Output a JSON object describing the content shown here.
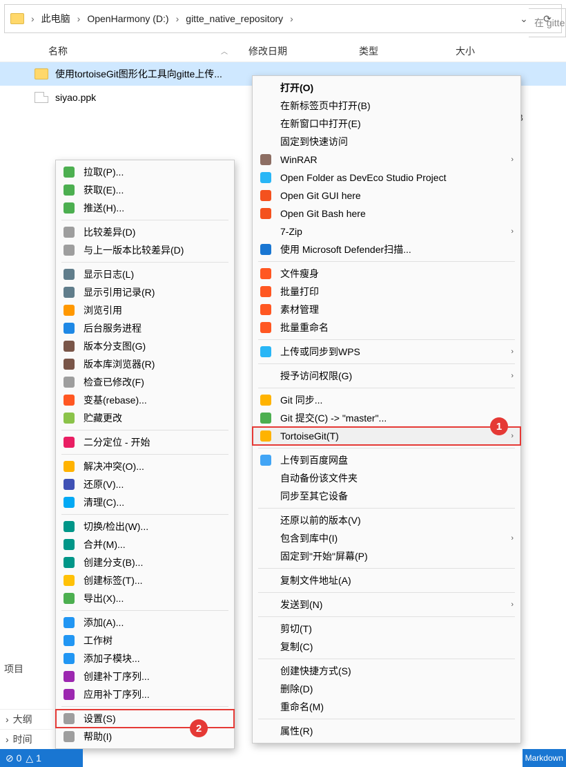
{
  "breadcrumb": {
    "pc": "此电脑",
    "drive": "OpenHarmony (D:)",
    "folder": "gitte_native_repository"
  },
  "search": {
    "prefix": "在 gitte"
  },
  "columns": {
    "name": "名称",
    "date": "修改日期",
    "type": "类型",
    "size": "大小"
  },
  "files": {
    "folder_name": "使用tortoiseGit图形化工具向gitte上传...",
    "file_name": "siyao.ppk",
    "size_suffix": "B"
  },
  "menu1": [
    {
      "k": "open",
      "label": "打开(O)",
      "bold": true
    },
    {
      "k": "newtab",
      "label": "在新标签页中打开(B)"
    },
    {
      "k": "newwin",
      "label": "在新窗口中打开(E)"
    },
    {
      "k": "pin",
      "label": "固定到快速访问"
    },
    {
      "k": "winrar",
      "label": "WinRAR",
      "arrow": true,
      "ico": "rar"
    },
    {
      "k": "deveco",
      "label": "Open Folder as DevEco Studio Project",
      "ico": "dev"
    },
    {
      "k": "gitgui",
      "label": "Open Git GUI here",
      "ico": "git"
    },
    {
      "k": "gitbash",
      "label": "Open Git Bash here",
      "ico": "git"
    },
    {
      "k": "7zip",
      "label": "7-Zip",
      "arrow": true
    },
    {
      "k": "defender",
      "label": "使用 Microsoft Defender扫描...",
      "ico": "shield"
    },
    {
      "sep": true
    },
    {
      "k": "wps1",
      "label": "文件瘦身",
      "ico": "w"
    },
    {
      "k": "wps2",
      "label": "批量打印",
      "ico": "w"
    },
    {
      "k": "wps3",
      "label": "素材管理",
      "ico": "w"
    },
    {
      "k": "wps4",
      "label": "批量重命名",
      "ico": "w"
    },
    {
      "sep": true
    },
    {
      "k": "wpsup",
      "label": "上传或同步到WPS",
      "arrow": true,
      "ico": "cloud"
    },
    {
      "sep": true
    },
    {
      "k": "grant",
      "label": "授予访问权限(G)",
      "arrow": true
    },
    {
      "sep": true
    },
    {
      "k": "gitsync",
      "label": "Git 同步...",
      "ico": "gs"
    },
    {
      "k": "gitcommit",
      "label": "Git 提交(C) -> \"master\"...",
      "ico": "gc"
    },
    {
      "k": "tortoise",
      "label": "TortoiseGit(T)",
      "arrow": true,
      "hl": true,
      "ico": "tg"
    },
    {
      "sep": true
    },
    {
      "k": "baidu",
      "label": "上传到百度网盘",
      "ico": "bd"
    },
    {
      "k": "autobk",
      "label": "自动备份该文件夹"
    },
    {
      "k": "syncdev",
      "label": "同步至其它设备"
    },
    {
      "sep": true
    },
    {
      "k": "restore",
      "label": "还原以前的版本(V)"
    },
    {
      "k": "include",
      "label": "包含到库中(I)",
      "arrow": true
    },
    {
      "k": "pinstart",
      "label": "固定到\"开始\"屏幕(P)"
    },
    {
      "sep": true
    },
    {
      "k": "copyaddr",
      "label": "复制文件地址(A)"
    },
    {
      "sep": true
    },
    {
      "k": "sendto",
      "label": "发送到(N)",
      "arrow": true
    },
    {
      "sep": true
    },
    {
      "k": "cut",
      "label": "剪切(T)"
    },
    {
      "k": "copy",
      "label": "复制(C)"
    },
    {
      "sep": true
    },
    {
      "k": "shortcut",
      "label": "创建快捷方式(S)"
    },
    {
      "k": "delete",
      "label": "删除(D)"
    },
    {
      "k": "rename",
      "label": "重命名(M)"
    },
    {
      "sep": true
    },
    {
      "k": "props",
      "label": "属性(R)"
    }
  ],
  "menu2": [
    {
      "k": "pull",
      "label": "拉取(P)...",
      "c": "#4caf50"
    },
    {
      "k": "fetch",
      "label": "获取(E)...",
      "c": "#4caf50"
    },
    {
      "k": "push",
      "label": "推送(H)...",
      "c": "#4caf50"
    },
    {
      "sep": true
    },
    {
      "k": "diff",
      "label": "比较差异(D)",
      "c": "#9e9e9e"
    },
    {
      "k": "diffprev",
      "label": "与上一版本比较差异(D)",
      "c": "#9e9e9e"
    },
    {
      "sep": true
    },
    {
      "k": "log",
      "label": "显示日志(L)",
      "c": "#607d8b"
    },
    {
      "k": "reflog",
      "label": "显示引用记录(R)",
      "c": "#607d8b"
    },
    {
      "k": "browse",
      "label": "浏览引用",
      "c": "#ff9800"
    },
    {
      "k": "daemon",
      "label": "后台服务进程",
      "c": "#1e88e5"
    },
    {
      "k": "revgraph",
      "label": "版本分支图(G)",
      "c": "#795548"
    },
    {
      "k": "repobrowser",
      "label": "版本库浏览器(R)",
      "c": "#795548"
    },
    {
      "k": "checkmod",
      "label": "检查已修改(F)",
      "c": "#9e9e9e"
    },
    {
      "k": "rebase",
      "label": "变基(rebase)...",
      "c": "#ff5722"
    },
    {
      "k": "stash",
      "label": "贮藏更改",
      "c": "#8bc34a"
    },
    {
      "sep": true
    },
    {
      "k": "bisect",
      "label": "二分定位 - 开始",
      "c": "#e91e63"
    },
    {
      "sep": true
    },
    {
      "k": "resolve",
      "label": "解决冲突(O)...",
      "c": "#ffb300"
    },
    {
      "k": "revert",
      "label": "还原(V)...",
      "c": "#3f51b5"
    },
    {
      "k": "clean",
      "label": "清理(C)...",
      "c": "#03a9f4"
    },
    {
      "sep": true
    },
    {
      "k": "switch",
      "label": "切换/检出(W)...",
      "c": "#009688"
    },
    {
      "k": "merge",
      "label": "合并(M)...",
      "c": "#009688"
    },
    {
      "k": "branch",
      "label": "创建分支(B)...",
      "c": "#009688"
    },
    {
      "k": "tag",
      "label": "创建标签(T)...",
      "c": "#ffc107"
    },
    {
      "k": "export",
      "label": "导出(X)...",
      "c": "#4caf50"
    },
    {
      "sep": true
    },
    {
      "k": "add",
      "label": "添加(A)...",
      "c": "#2196f3"
    },
    {
      "k": "worktree",
      "label": "工作树",
      "c": "#2196f3"
    },
    {
      "k": "submodule",
      "label": "添加子模块...",
      "c": "#2196f3"
    },
    {
      "k": "createpatch",
      "label": "创建补丁序列...",
      "c": "#9c27b0"
    },
    {
      "k": "applypatch",
      "label": "应用补丁序列...",
      "c": "#9c27b0"
    },
    {
      "sep": true
    },
    {
      "k": "settings",
      "label": "设置(S)",
      "c": "#9e9e9e",
      "hl": true
    },
    {
      "k": "help",
      "label": "帮助(I)",
      "c": "#9e9e9e"
    }
  ],
  "badges": {
    "one": "1",
    "two": "2"
  },
  "strip": {
    "err": "⊘ 0",
    "warn": "△ 1",
    "outline": "大纲",
    "time": "时间",
    "proj": "项目",
    "md": "Markdown"
  }
}
